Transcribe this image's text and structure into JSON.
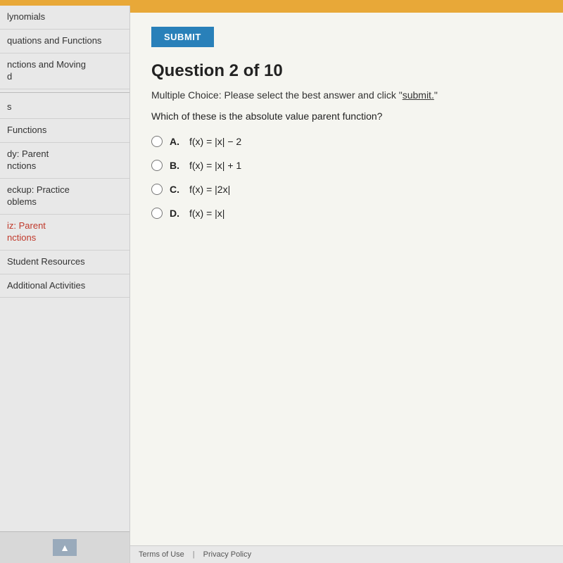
{
  "topBar": {
    "color": "#e8a838"
  },
  "sidebar": {
    "items": [
      {
        "id": "polynomials",
        "label": "lynomials",
        "active": false,
        "highlighted": false
      },
      {
        "id": "equations-functions",
        "label": "quations and Functions",
        "active": false,
        "highlighted": false
      },
      {
        "id": "functions-moving",
        "label": "nctions and Moving\nd",
        "active": false,
        "highlighted": false
      },
      {
        "id": "sep1",
        "type": "divider"
      },
      {
        "id": "item-s",
        "label": "s",
        "active": false,
        "highlighted": false
      },
      {
        "id": "functions",
        "label": "Functions",
        "active": false,
        "highlighted": false
      },
      {
        "id": "study-parent",
        "label": "dy: Parent\nnctions",
        "active": false,
        "highlighted": false
      },
      {
        "id": "checkup-practice",
        "label": "eckup: Practice\noblems",
        "active": false,
        "highlighted": false
      },
      {
        "id": "quiz-parent",
        "label": "iz: Parent\nnctions",
        "active": true,
        "highlighted": true
      },
      {
        "id": "student-resources",
        "label": "Student Resources",
        "active": false,
        "highlighted": false
      },
      {
        "id": "additional-activities",
        "label": "Additional Activities",
        "active": false,
        "highlighted": false
      }
    ],
    "scrollButtonLabel": "▲",
    "footerLinks": [
      {
        "label": "Terms of Use"
      },
      {
        "label": "Privacy Policy"
      }
    ]
  },
  "content": {
    "submitLabel": "SUBMIT",
    "questionTitle": "Question 2 of 10",
    "instruction": "Multiple Choice: Please select the best answer and click \"submit.\"",
    "questionText": "Which of these is the absolute value parent function?",
    "answers": [
      {
        "id": "A",
        "label": "A.",
        "formula": "f(x) = |x| − 2"
      },
      {
        "id": "B",
        "label": "B.",
        "formula": "f(x) = |x| + 1"
      },
      {
        "id": "C",
        "label": "C.",
        "formula": "f(x) = |2x|"
      },
      {
        "id": "D",
        "label": "D.",
        "formula": "f(x) = |x|"
      }
    ]
  },
  "footer": {
    "links": [
      "Terms of Use",
      "Privacy Policy"
    ],
    "separator": "|"
  }
}
